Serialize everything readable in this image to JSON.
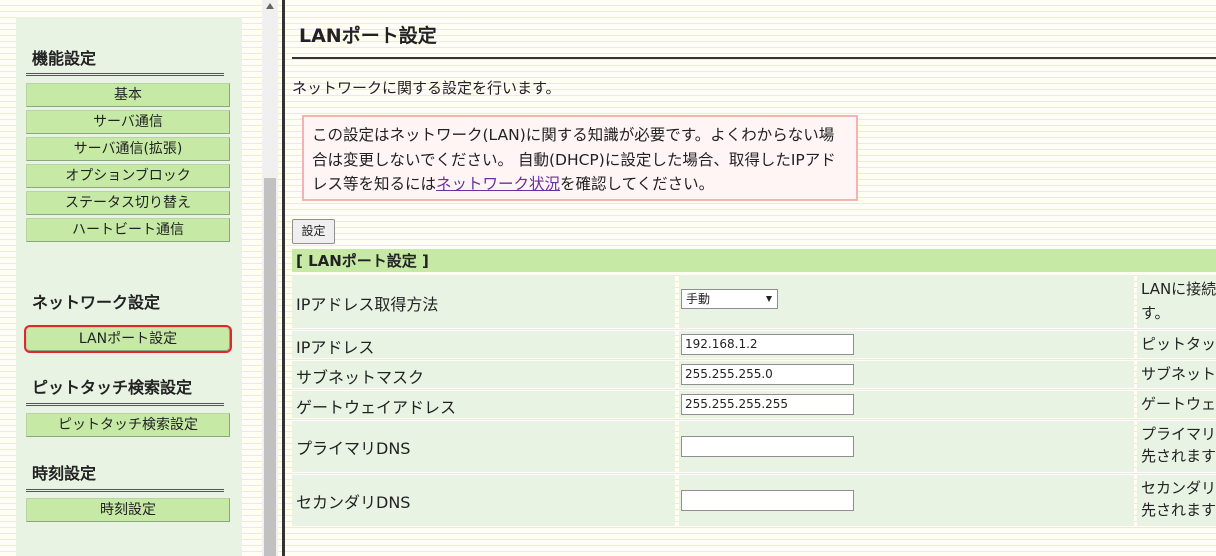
{
  "nav": {
    "sections": [
      {
        "heading": "機能設定",
        "items": [
          "基本",
          "サーバ通信",
          "サーバ通信(拡張)",
          "オプションブロック",
          "ステータス切り替え",
          "ハートビート通信"
        ]
      },
      {
        "heading": "ネットワーク設定",
        "items": [
          "LANポート設定"
        ]
      },
      {
        "heading": "ピットタッチ検索設定",
        "items": [
          "ピットタッチ検索設定"
        ]
      },
      {
        "heading": "時刻設定",
        "items": [
          "時刻設定"
        ]
      }
    ],
    "selected_item": "LANポート設定"
  },
  "page": {
    "title": "LANポート設定",
    "description": "ネットワークに関する設定を行います。",
    "notice": {
      "before_link": "この設定はネットワーク(LAN)に関する知識が必要です。よくわからない場合は変更しないでください。 自動(DHCP)に設定した場合、取得したIPアドレス等を知るには",
      "link_text": "ネットワーク状況",
      "after_link": "を確認してください。"
    },
    "apply_button": "設定",
    "section_title": "[ LANポート設定 ]"
  },
  "form": {
    "rows": [
      {
        "label": "IPアドレス取得方法",
        "value": "手動",
        "desc": [
          "LANに接続",
          "す。"
        ]
      },
      {
        "label": "IPアドレス",
        "value": "192.168.1.2",
        "desc": [
          "ピットタッ"
        ]
      },
      {
        "label": "サブネットマスク",
        "value": "255.255.255.0",
        "desc": [
          "サブネット"
        ]
      },
      {
        "label": "ゲートウェイアドレス",
        "value": "255.255.255.255",
        "desc": [
          "ゲートウェ"
        ]
      },
      {
        "label": "プライマリDNS",
        "value": "",
        "desc": [
          "プライマリ",
          "先されます"
        ]
      },
      {
        "label": "セカンダリDNS",
        "value": "",
        "desc": [
          "セカンダリ",
          "先されます"
        ]
      }
    ]
  },
  "colors": {
    "nav_button": "#c6eaa6",
    "panel": "#e8f3e4",
    "selected_outline": "#e0282c",
    "notice_border": "#f2b3b3",
    "link": "#6a2fa0"
  }
}
